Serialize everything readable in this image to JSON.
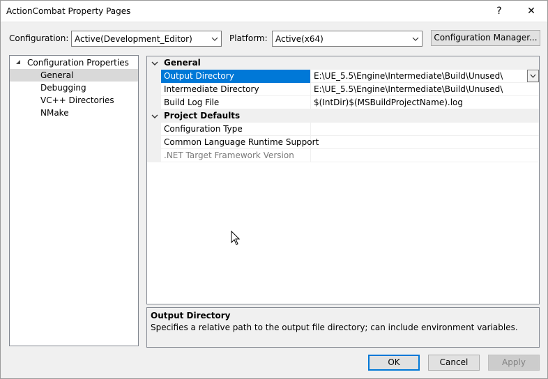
{
  "window": {
    "title": "ActionCombat Property Pages",
    "help_glyph": "?",
    "close_glyph": "✕"
  },
  "toolbar": {
    "configuration_label": "Configuration:",
    "configuration_value": "Active(Development_Editor)",
    "platform_label": "Platform:",
    "platform_value": "Active(x64)",
    "config_manager_label": "Configuration Manager..."
  },
  "tree": {
    "root": "Configuration Properties",
    "items": [
      {
        "label": "General",
        "selected": true
      },
      {
        "label": "Debugging"
      },
      {
        "label": "VC++ Directories"
      },
      {
        "label": "NMake"
      }
    ]
  },
  "grid": {
    "categories": [
      {
        "label": "General",
        "rows": [
          {
            "name": "Output Directory",
            "value": "E:\\UE_5.5\\Engine\\Intermediate\\Build\\Unused\\"
          },
          {
            "name": "Intermediate Directory",
            "value": "E:\\UE_5.5\\Engine\\Intermediate\\Build\\Unused\\"
          },
          {
            "name": "Build Log File",
            "value": "$(IntDir)$(MSBuildProjectName).log"
          }
        ]
      },
      {
        "label": "Project Defaults",
        "rows": [
          {
            "name": "Configuration Type",
            "value": ""
          },
          {
            "name": "Common Language Runtime Support",
            "value": ""
          },
          {
            "name": ".NET Target Framework Version",
            "value": ""
          }
        ]
      }
    ]
  },
  "description": {
    "title": "Output Directory",
    "text": "Specifies a relative path to the output file directory; can include environment variables."
  },
  "buttons": {
    "ok": "OK",
    "cancel": "Cancel",
    "apply": "Apply"
  },
  "colors": {
    "selection": "#0078d7",
    "default_button_border": "#0078d7"
  }
}
